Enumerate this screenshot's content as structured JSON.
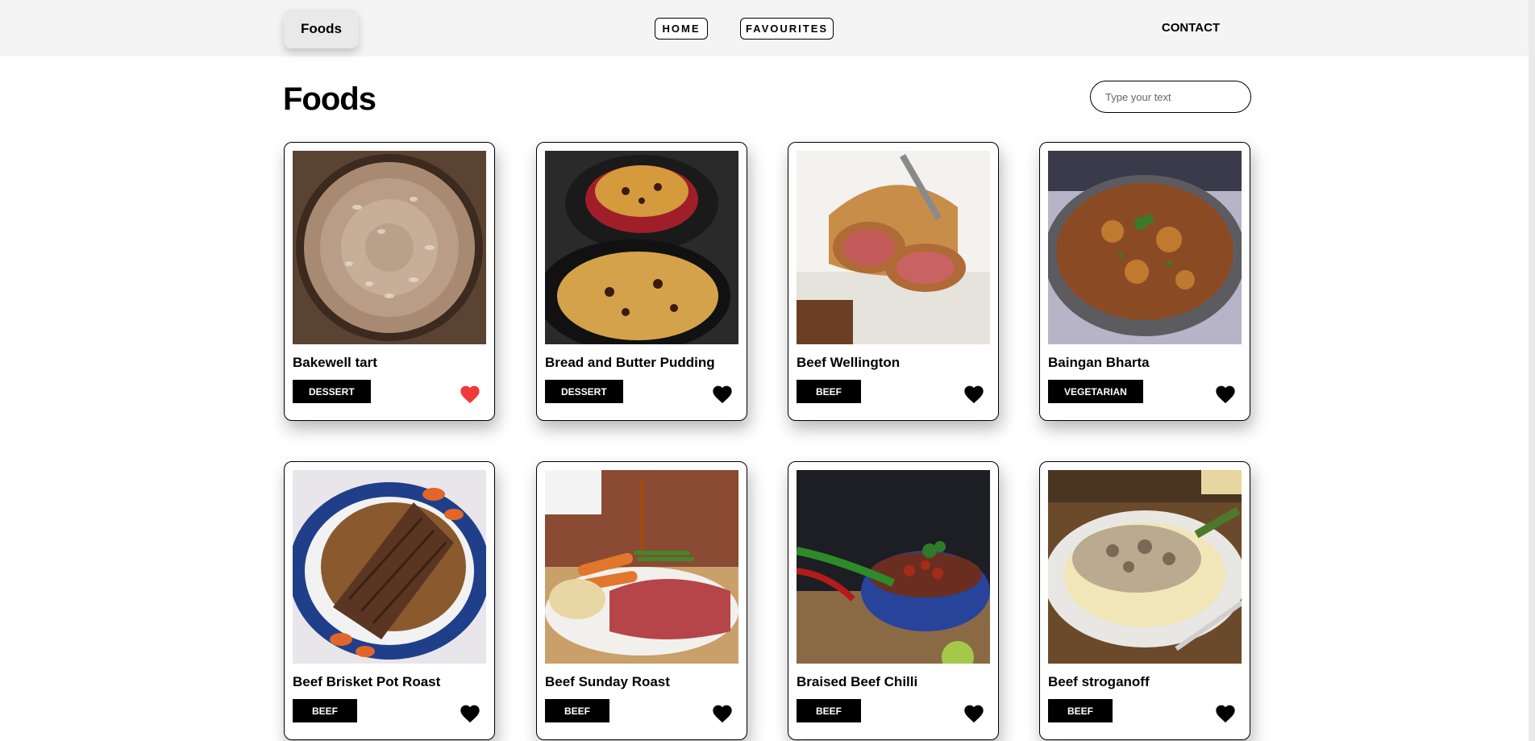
{
  "brand": "Foods",
  "nav": {
    "home": "HOME",
    "favourites": "FAVOURITES",
    "contact": "CONTACT"
  },
  "page_title": "Foods",
  "search": {
    "placeholder": "Type your text",
    "value": ""
  },
  "colors": {
    "favourite": "#f03a3a",
    "not_favourite": "#000000",
    "header_bg": "#f4f4f4"
  },
  "foods": [
    {
      "name": "Bakewell tart",
      "category": "DESSERT",
      "favourite": true
    },
    {
      "name": "Bread and Butter Pudding",
      "category": "DESSERT",
      "favourite": false
    },
    {
      "name": "Beef Wellington",
      "category": "BEEF",
      "favourite": false
    },
    {
      "name": "Baingan Bharta",
      "category": "VEGETARIAN",
      "favourite": false
    },
    {
      "name": "Beef Brisket Pot Roast",
      "category": "BEEF",
      "favourite": false
    },
    {
      "name": "Beef Sunday Roast",
      "category": "BEEF",
      "favourite": false
    },
    {
      "name": "Braised Beef Chilli",
      "category": "BEEF",
      "favourite": false
    },
    {
      "name": "Beef stroganoff",
      "category": "BEEF",
      "favourite": false
    }
  ]
}
